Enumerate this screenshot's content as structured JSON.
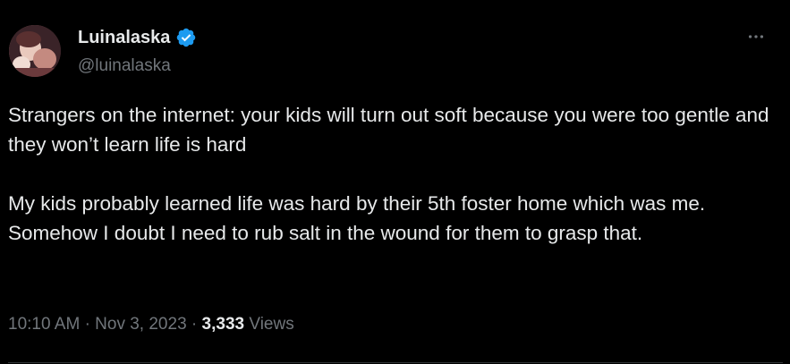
{
  "author": {
    "display_name": "Luinalaska",
    "handle": "@luinalaska",
    "verified": true,
    "verified_icon": "verified-badge-icon",
    "avatar": "avatar"
  },
  "tweet": {
    "paragraphs": [
      "Strangers on the internet: your kids will turn out soft because you were too gentle and they won’t learn life is hard",
      "My kids probably learned life was hard by their 5th foster home which was me. Somehow I doubt I need to rub salt in the wound for them to grasp that."
    ],
    "time": "10:10 AM",
    "date": "Nov 3, 2023",
    "separator": "·",
    "views_count": "3,333",
    "views_label": "Views"
  },
  "more_icon": "more-horizontal-icon",
  "colors": {
    "background": "#000000",
    "text_primary": "#e7e9ea",
    "text_secondary": "#71767b",
    "verified_blue": "#1d9bf0",
    "divider": "#2f3336"
  }
}
